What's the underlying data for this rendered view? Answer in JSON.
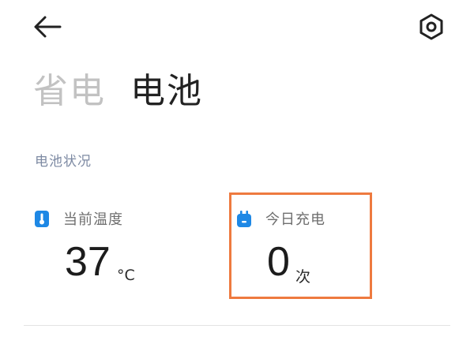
{
  "header": {
    "back_icon": "arrow-left-icon",
    "settings_icon": "hexagon-gear-icon"
  },
  "tabs": [
    {
      "label": "省电",
      "active": false
    },
    {
      "label": "电池",
      "active": true
    }
  ],
  "battery_status": {
    "section_title": "电池状况",
    "temperature": {
      "label": "当前温度",
      "value": "37",
      "unit": "°C",
      "icon": "thermometer-icon",
      "icon_color": "#1e88e5"
    },
    "charges_today": {
      "label": "今日充电",
      "value": "0",
      "unit": "次",
      "icon": "charger-plug-icon",
      "icon_color": "#1e88e5"
    }
  },
  "colors": {
    "highlight": "#ee7a3f",
    "section_title": "#7d8aa3",
    "tab_inactive": "#c2c2c2",
    "tab_active": "#222222"
  }
}
